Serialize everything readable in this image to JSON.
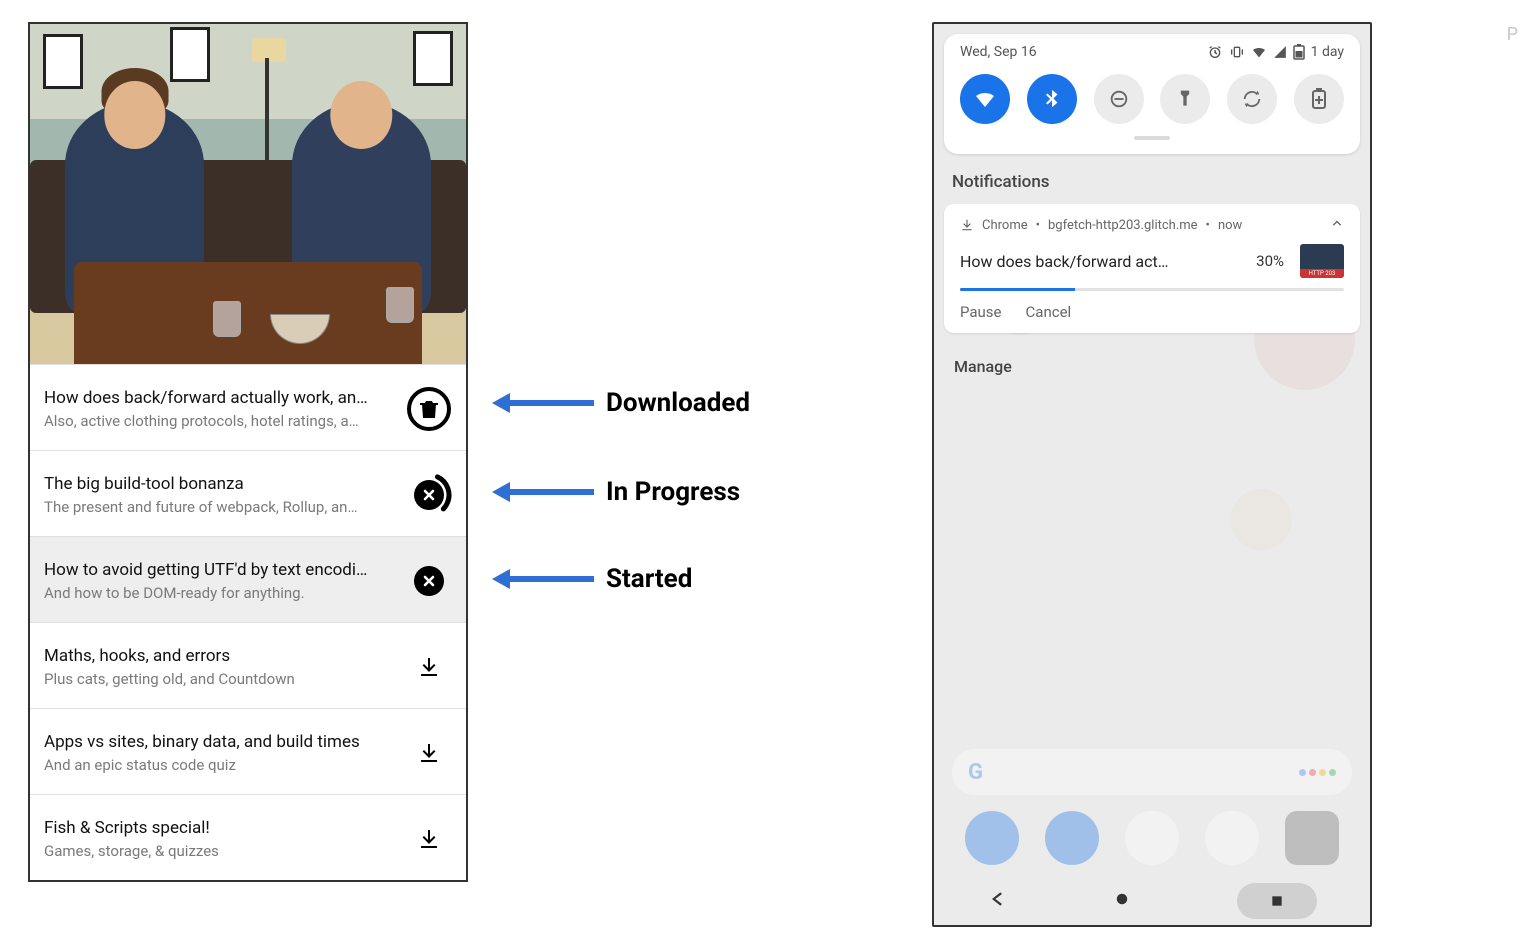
{
  "episodes": [
    {
      "title": "How does back/forward actually work, an…",
      "subtitle": "Also, active clothing protocols, hotel ratings, a…",
      "state": "downloaded"
    },
    {
      "title": "The big build-tool bonanza",
      "subtitle": "The present and future of webpack, Rollup, an…",
      "state": "in_progress"
    },
    {
      "title": "How to avoid getting UTF'd by text encodi…",
      "subtitle": "And how to be DOM-ready for anything.",
      "state": "started",
      "selected": true
    },
    {
      "title": "Maths, hooks, and errors",
      "subtitle": "Plus cats, getting old, and Countdown",
      "state": "idle"
    },
    {
      "title": "Apps vs sites, binary data, and build times",
      "subtitle": "And an epic status code quiz",
      "state": "idle"
    },
    {
      "title": "Fish & Scripts special!",
      "subtitle": "Games, storage, & quizzes",
      "state": "idle"
    }
  ],
  "annotations": {
    "downloaded": "Downloaded",
    "in_progress": "In Progress",
    "started": "Started"
  },
  "android": {
    "date": "Wed, Sep 16",
    "battery_text": "1 day",
    "section_title": "Notifications",
    "notification": {
      "app": "Chrome",
      "source": "bgfetch-http203.glitch.me",
      "time": "now",
      "title": "How does back/forward act…",
      "percent_label": "30%",
      "percent_value": 30,
      "actions": {
        "pause": "Pause",
        "cancel": "Cancel"
      }
    },
    "manage": "Manage"
  },
  "stray": "P"
}
